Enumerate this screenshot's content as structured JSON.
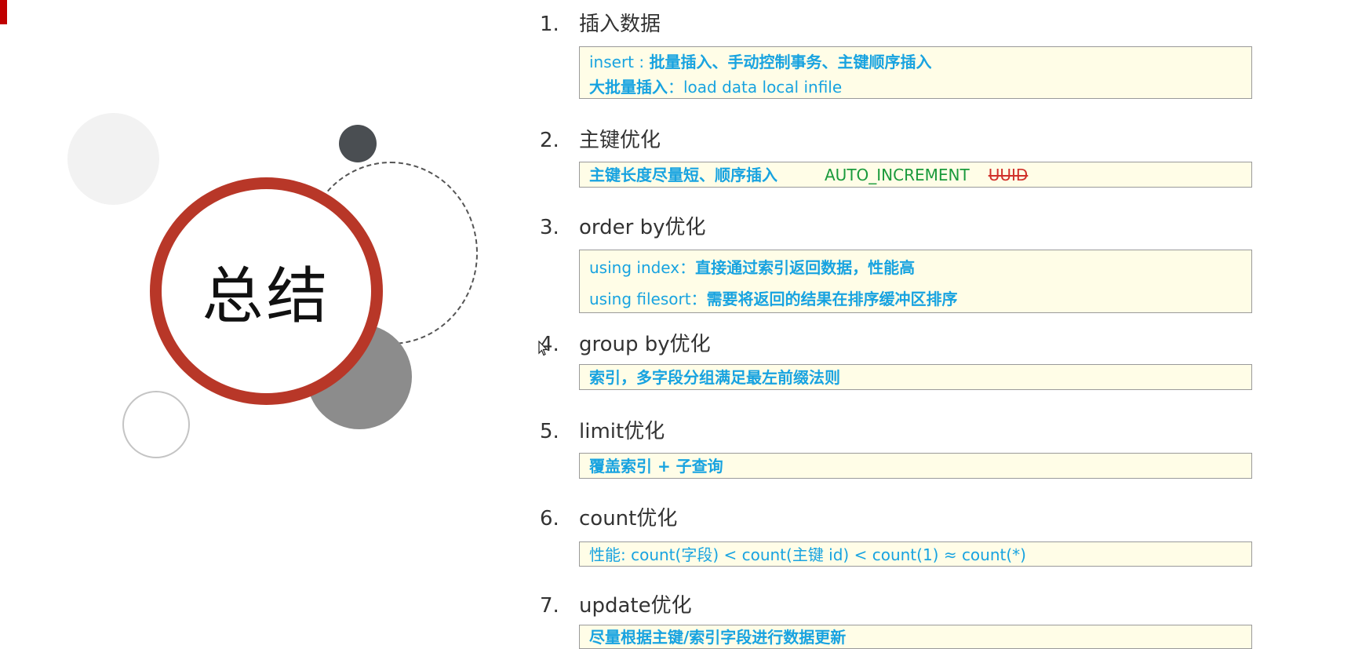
{
  "summary_title": "总结",
  "sections": [
    {
      "num": "1.",
      "title": "插入数据",
      "lines": [
        {
          "a": "insert : ",
          "b": "批量插入、手动控制事务、主键顺序插入"
        },
        {
          "a": "大批量插入",
          "b": "：load  data  local  infile"
        }
      ]
    },
    {
      "num": "2.",
      "title": "主键优化",
      "lines": [
        {
          "a": "主键长度尽量短、顺序插入",
          "green": "AUTO_INCREMENT",
          "strike": "UUID"
        }
      ]
    },
    {
      "num": "3.",
      "title": "order by优化",
      "lines": [
        {
          "a": "using index：",
          "b": "直接通过索引返回数据，性能高"
        },
        {
          "a": "using filesort：",
          "b": "需要将返回的结果在排序缓冲区排序"
        }
      ]
    },
    {
      "num": "4.",
      "title": "group by优化",
      "lines": [
        {
          "a": "索引，多字段分组满足最左前缀法则"
        }
      ]
    },
    {
      "num": "5.",
      "title": "limit优化",
      "lines": [
        {
          "a": "覆盖索引 + 子查询"
        }
      ]
    },
    {
      "num": "6.",
      "title": "count优化",
      "lines": [
        {
          "a": "性能: count(字段) < count(主键 id) < count(1) ≈ count(*)"
        }
      ]
    },
    {
      "num": "7.",
      "title": "update优化",
      "lines": [
        {
          "a": "尽量根据主键/索引字段进行数据更新"
        }
      ]
    }
  ],
  "colors": {
    "accent_red": "#b83728",
    "box_bg": "#fffde7",
    "text_blue": "#18a3e0",
    "green": "#1a9a3c"
  },
  "icons": {
    "cursor": "mouse-pointer-icon"
  }
}
